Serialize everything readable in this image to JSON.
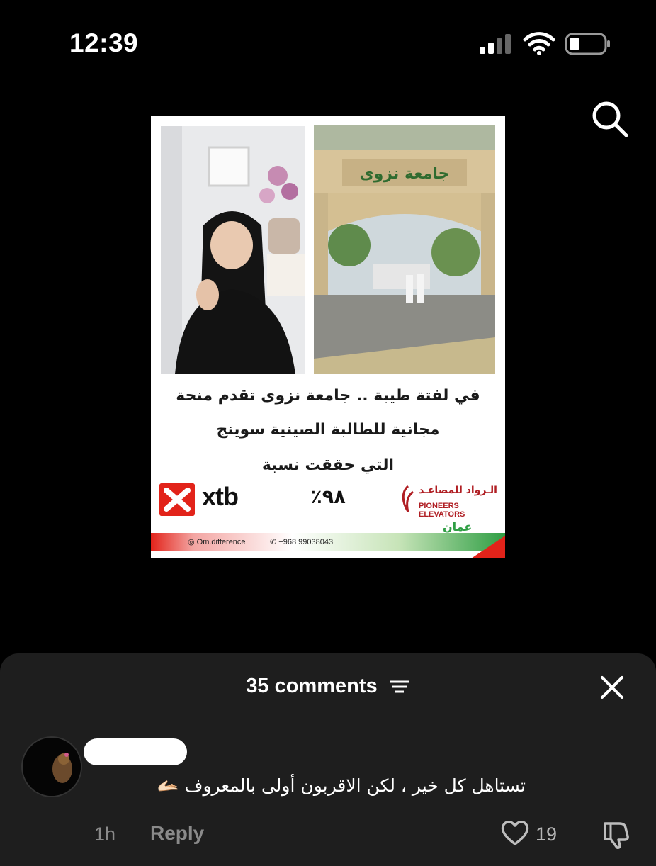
{
  "status_bar": {
    "time": "12:39",
    "signal_icon": "cellular-signal-icon",
    "wifi_icon": "wifi-icon",
    "battery_icon": "battery-low-icon"
  },
  "header": {
    "search_icon": "search-icon"
  },
  "post": {
    "headline_line1": "في لفتة طيبة  ..  جامعة نزوى تقدم منحة",
    "headline_line2": "مجانية للطالبة الصينية سوينج",
    "headline_line3": "التي حققت نسبة",
    "percent": "٩٨٪",
    "sponsor_left": "xtb",
    "sponsor_right_ar": "الـرواد للمصاعـد",
    "sponsor_right_en": "PIONEERS ELEVATORS",
    "footer_instagram": "Om.difference",
    "footer_whatsapp": "+968 99038043",
    "logo_text": "عمان"
  },
  "comments": {
    "count_label": "35 comments",
    "sort_icon": "sort-lines-icon",
    "close_icon": "close-icon",
    "items": [
      {
        "text": "تستاهل كل خير ، لكن الاقربون أولى بالمعروف 🫴🏻",
        "time": "1h",
        "reply_label": "Reply",
        "likes": "19"
      }
    ]
  },
  "colors": {
    "background": "#000000",
    "sheet": "#1e1e1e",
    "muted_text": "#8a8a8a",
    "brand_red": "#e2231a",
    "brand_green": "#2f9e44"
  }
}
